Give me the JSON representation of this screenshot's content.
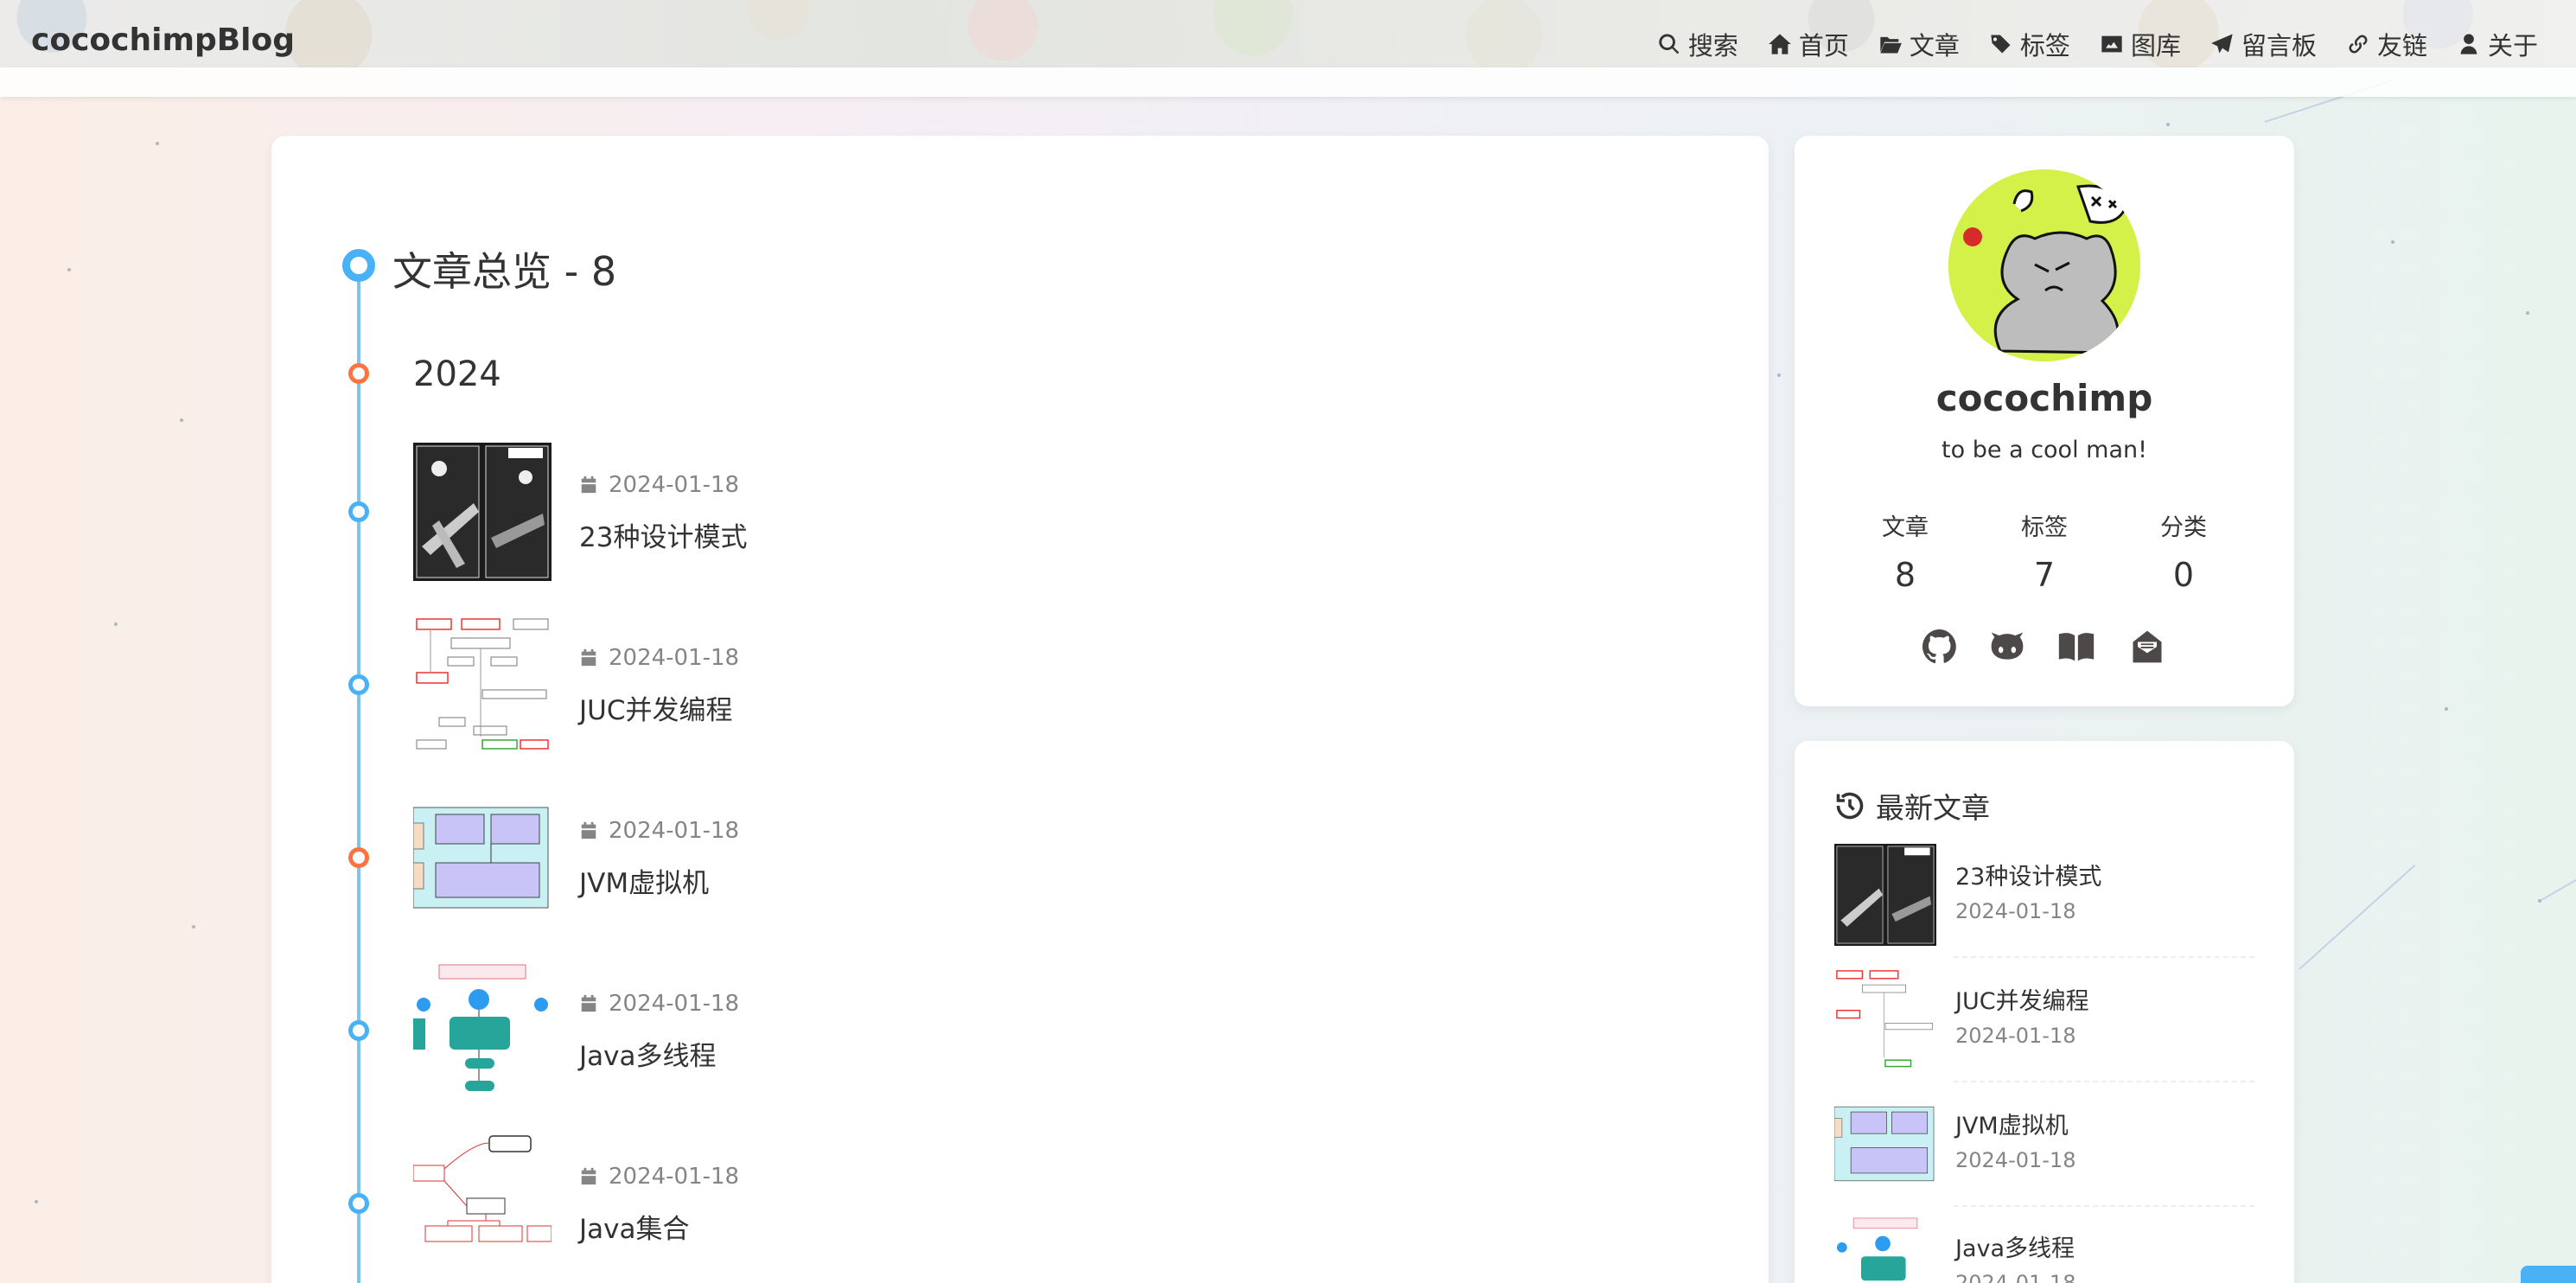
{
  "header": {
    "logo": "cocochimpBlog",
    "nav": [
      {
        "label": "搜索",
        "icon": "search-icon"
      },
      {
        "label": "首页",
        "icon": "home-icon"
      },
      {
        "label": "文章",
        "icon": "folder-open-icon"
      },
      {
        "label": "标签",
        "icon": "tags-icon"
      },
      {
        "label": "图库",
        "icon": "image-icon"
      },
      {
        "label": "留言板",
        "icon": "paper-plane-icon"
      },
      {
        "label": "友链",
        "icon": "link-icon"
      },
      {
        "label": "关于",
        "icon": "user-icon"
      }
    ]
  },
  "archive": {
    "title": "文章总览 - 8",
    "year": "2024",
    "posts": [
      {
        "date": "2024-01-18",
        "title": "23种设计模式",
        "thumb": "design-patterns-thumbnail",
        "dot": "#49b1f5"
      },
      {
        "date": "2024-01-18",
        "title": "JUC并发编程",
        "thumb": "juc-diagram-thumbnail",
        "dot": "#49b1f5"
      },
      {
        "date": "2024-01-18",
        "title": "JVM虚拟机",
        "thumb": "jvm-diagram-thumbnail",
        "dot": "#ff7242"
      },
      {
        "date": "2024-01-18",
        "title": "Java多线程",
        "thumb": "multithread-diagram-thumbnail",
        "dot": "#49b1f5"
      },
      {
        "date": "2024-01-18",
        "title": "Java集合",
        "thumb": "collections-diagram-thumbnail",
        "dot": "#49b1f5"
      }
    ]
  },
  "profile": {
    "author": "cocochimp",
    "description": "to be a cool man!",
    "stats": [
      {
        "label": "文章",
        "value": "8"
      },
      {
        "label": "标签",
        "value": "7"
      },
      {
        "label": "分类",
        "value": "0"
      }
    ],
    "social": [
      "github-icon",
      "gitee-icon",
      "book-icon",
      "mail-icon"
    ]
  },
  "recent": {
    "header": "最新文章",
    "items": [
      {
        "title": "23种设计模式",
        "date": "2024-01-18"
      },
      {
        "title": "JUC并发编程",
        "date": "2024-01-18"
      },
      {
        "title": "JVM虚拟机",
        "date": "2024-01-18"
      },
      {
        "title": "Java多线程",
        "date": "2024-01-18"
      }
    ]
  },
  "colors": {
    "accent": "#49b1f5",
    "orange": "#ff7242",
    "text": "#333333",
    "muted": "#858585"
  }
}
